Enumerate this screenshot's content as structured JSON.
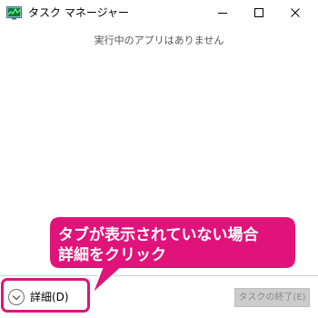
{
  "window": {
    "title": "タスク マネージャー",
    "controls": {
      "minimize": "minimize",
      "maximize": "maximize",
      "close": "close"
    }
  },
  "main": {
    "empty_message": "実行中のアプリはありません"
  },
  "footer": {
    "details_label": "詳細(D)",
    "end_task_label": "タスクの終了(E)",
    "end_task_enabled": false
  },
  "annotation": {
    "line1": "タブが表示されていない場合",
    "line2": "詳細をクリック",
    "accent_color": "#e0137a"
  },
  "icons": {
    "app": "task-manager-icon",
    "details": "chevron-down-circle-icon"
  }
}
